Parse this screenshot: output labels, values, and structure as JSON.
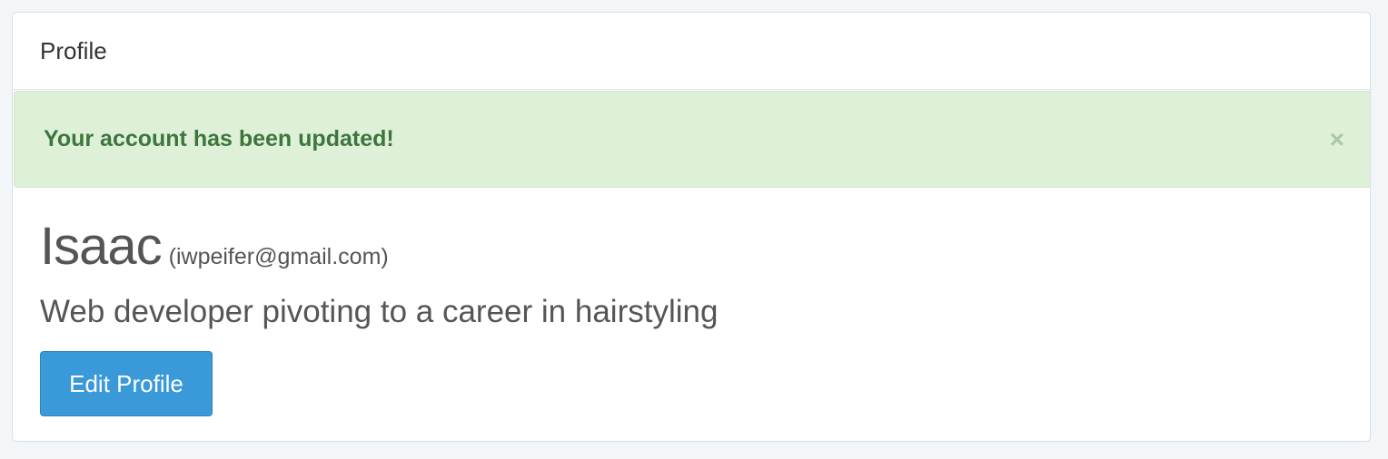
{
  "panel": {
    "title": "Profile"
  },
  "alert": {
    "message": "Your account has been updated!",
    "close_glyph": "×",
    "colors": {
      "background": "#dff0d8",
      "text": "#3c763d"
    }
  },
  "profile": {
    "name": "Isaac",
    "email": "(iwpeifer@gmail.com)",
    "bio": "Web developer pivoting to a career in hairstyling",
    "edit_button_label": "Edit Profile"
  },
  "colors": {
    "accent": "#3a99d8"
  }
}
